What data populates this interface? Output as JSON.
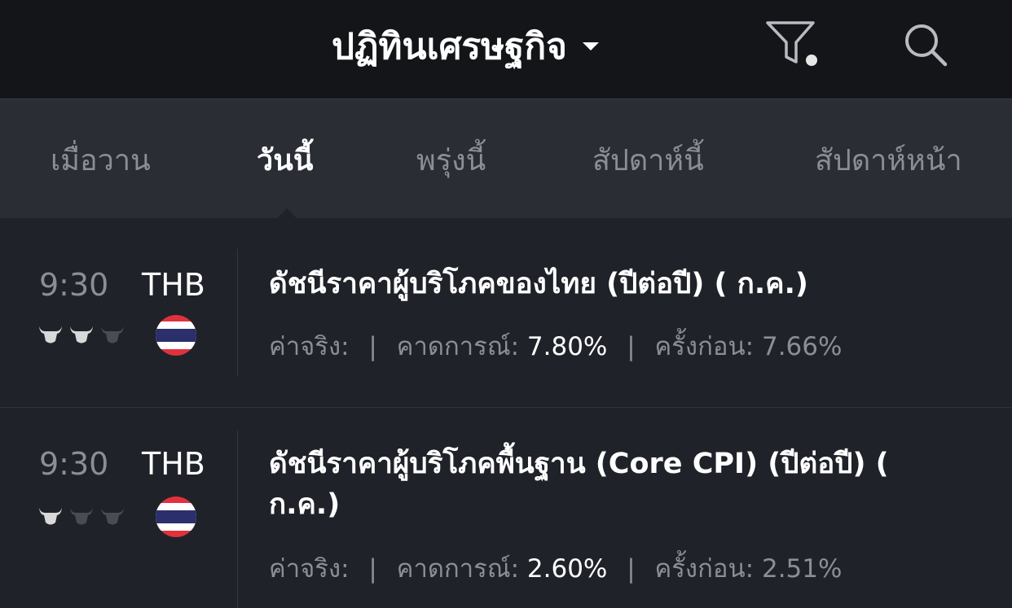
{
  "header": {
    "title": "ปฏิทินเศรษฐกิจ",
    "dropdown_icon": "chevron-down-icon",
    "filter_icon": "filter-icon",
    "search_icon": "search-icon"
  },
  "tabs": [
    {
      "label": "เมื่อวาน",
      "active": false
    },
    {
      "label": "วันนี้",
      "active": true
    },
    {
      "label": "พรุ่งนี้",
      "active": false
    },
    {
      "label": "สัปดาห์นี้",
      "active": false
    },
    {
      "label": "สัปดาห์หน้า",
      "active": false
    }
  ],
  "events": [
    {
      "time": "9:30",
      "currency": "THB",
      "importance": 2,
      "importance_max": 3,
      "flag": "thailand-flag",
      "title": "ดัชนีราคาผู้บริโภคของไทย (ปีต่อปี) ( ก.ค.)",
      "actual_label": "ค่าจริง:",
      "actual_value": "",
      "forecast_label": "คาดการณ์:",
      "forecast_value": "7.80%",
      "previous_label": "ครั้งก่อน:",
      "previous_value": "7.66%"
    },
    {
      "time": "9:30",
      "currency": "THB",
      "importance": 1,
      "importance_max": 3,
      "flag": "thailand-flag",
      "title": "ดัชนีราคาผู้บริโภคพื้นฐาน (Core CPI) (ปีต่อปี) ( ก.ค.)",
      "actual_label": "ค่าจริง:",
      "actual_value": "",
      "forecast_label": "คาดการณ์:",
      "forecast_value": "2.60%",
      "previous_label": "ครั้งก่อน:",
      "previous_value": "2.51%"
    }
  ],
  "colors": {
    "header_bg": "#131519",
    "tabs_bg": "#2a2d34",
    "list_bg": "#1f2228",
    "text_primary": "#ffffff",
    "text_muted": "#8b8e94",
    "bull_active": "#d9d9d9",
    "bull_inactive": "#4a4c52",
    "flag_red": "#e0323d",
    "flag_white": "#ffffff",
    "flag_blue": "#2b2f6b"
  }
}
